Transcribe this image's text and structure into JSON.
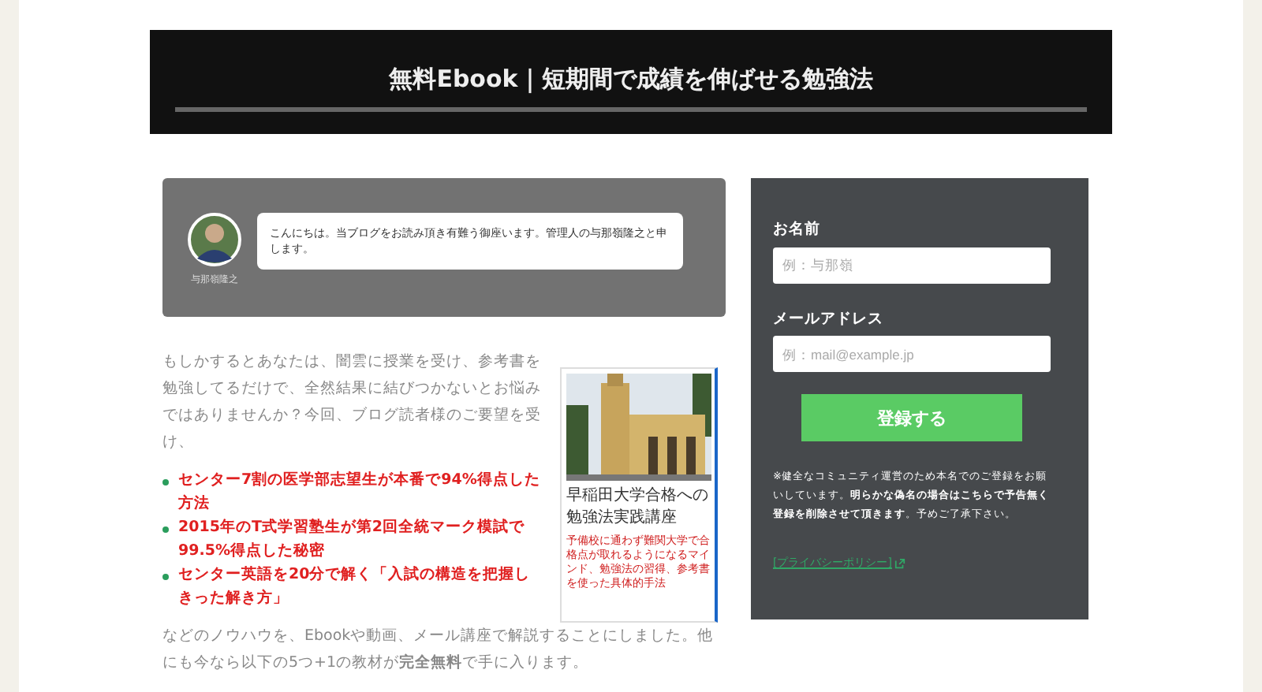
{
  "header": {
    "title": "無料Ebook｜短期間で成績を伸ばせる勉強法"
  },
  "greeting": {
    "author": "与那嶺隆之",
    "message": "こんにちは。当ブログをお読み頂き有難う御座います。管理人の与那嶺隆之と申します。"
  },
  "intro": "もしかするとあなたは、闇雲に授業を受け、参考書を勉強してるだけで、全然結果に結びつかないとお悩みではありませんか？今回、ブログ読者様のご要望を受け、",
  "highlights": [
    "センター7割の医学部志望生が本番で94%得点した方法",
    "2015年のT式学習塾生が第2回全統マーク模試で99.5%得点した秘密",
    "センター英語を20分で解く「入試の構造を把握しきった解き方」"
  ],
  "outro": "などのノウハウを、Ebookや動画、メール講座で解説することにしました。他にも今なら以下の5つ+1の教材が**完全無料**で手に入ります。",
  "book": {
    "kind": "picture",
    "title": "早稲田大学合格への勉強法実践講座",
    "subtitle": "予備校に通わず難関大学で合格点が取れるようになるマインド、勉強法の習得、参考書を使った具体的手法"
  },
  "form": {
    "fields": [
      {
        "label": "お名前",
        "placeholder": "例：与那嶺"
      },
      {
        "label": "メールアドレス",
        "placeholder": "例：mail@example.jp"
      }
    ],
    "submit": "登録する",
    "notice": "※健全なコミュニティ運営のため本名でのご登録をお願いしています。**明らかな偽名の場合はこちらで予告無く登録を削除させて頂きます**。予めご了承下さい。",
    "privacy_link": "[プライバシーポリシー]"
  }
}
